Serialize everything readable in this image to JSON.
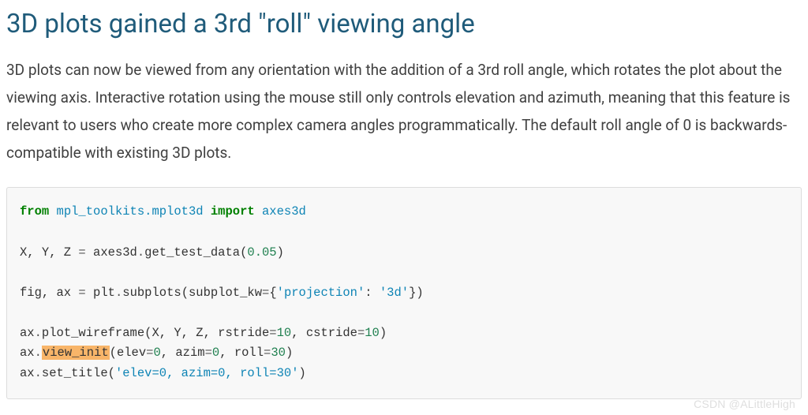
{
  "heading": "3D plots gained a 3rd \"roll\" viewing angle",
  "paragraph": "3D plots can now be viewed from any orientation with the addition of a 3rd roll angle, which rotates the plot about the viewing axis. Interactive rotation using the mouse still only controls elevation and azimuth, meaning that this feature is relevant to users who create more complex camera angles programmatically. The default roll angle of 0 is backwards-compatible with existing 3D plots.",
  "code": {
    "kw_from": "from",
    "mod1": "mpl_toolkits.mplot3d",
    "kw_import": "import",
    "mod2": "axes3d",
    "line2_vars": "X, Y, Z ",
    "line2_eq": "=",
    "line2_call": " axes3d",
    "line2_dot": ".",
    "line2_fn": "get_test_data",
    "line2_open": "(",
    "line2_num": "0.05",
    "line2_close": ")",
    "line3_vars": "fig, ax ",
    "line3_eq": "=",
    "line3_plt": " plt",
    "line3_dot": ".",
    "line3_fn": "subplots",
    "line3_open": "(",
    "line3_arg": "subplot_kw",
    "line3_eq2": "=",
    "line3_brace": "{",
    "line3_k": "'projection'",
    "line3_colon": ": ",
    "line3_v": "'3d'",
    "line3_brace2": "}",
    "line3_close": ")",
    "line4_ax": "ax",
    "line4_dot": ".",
    "line4_fn": "plot_wireframe",
    "line4_args": "(X, Y, Z, rstride",
    "line4_eq": "=",
    "line4_n1": "10",
    "line4_c": ", cstride",
    "line4_eq2": "=",
    "line4_n2": "10",
    "line4_close": ")",
    "line5_ax": "ax",
    "line5_dot": ".",
    "line5_fn": "view_init",
    "line5_open": "(elev",
    "line5_eq": "=",
    "line5_n1": "0",
    "line5_c1": ", azim",
    "line5_eq2": "=",
    "line5_n2": "0",
    "line5_c2": ", roll",
    "line5_eq3": "=",
    "line5_n3": "30",
    "line5_close": ")",
    "line6_ax": "ax",
    "line6_dot": ".",
    "line6_fn": "set_title",
    "line6_open": "(",
    "line6_str": "'elev=0, azim=0, roll=30'",
    "line6_close": ")"
  },
  "watermark": "CSDN @ALittleHigh"
}
